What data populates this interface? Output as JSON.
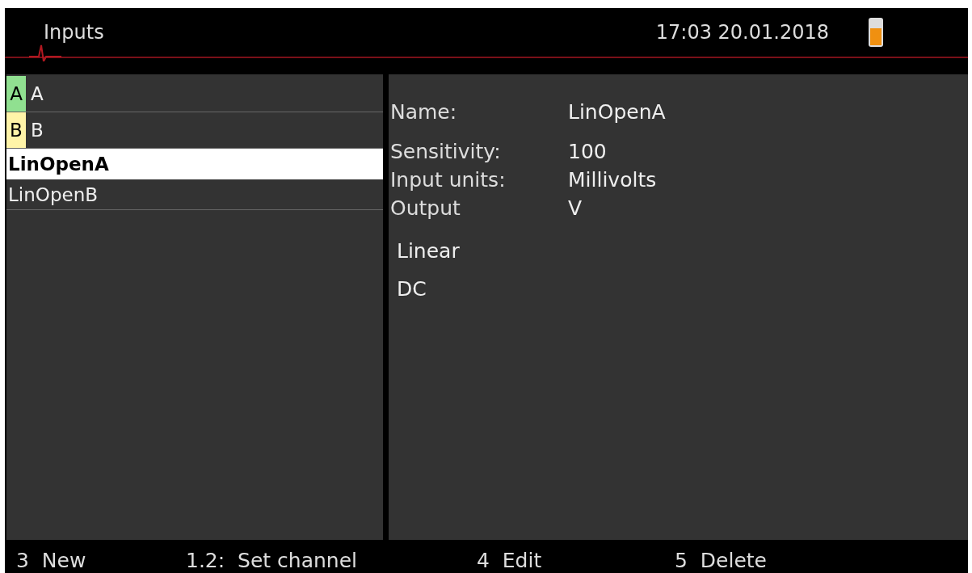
{
  "header": {
    "title": "Inputs",
    "datetime": "17:03 20.01.2018"
  },
  "inputs": [
    {
      "kind": "channel",
      "tag": "A",
      "color": "#90e090",
      "label": "A",
      "selected": false
    },
    {
      "kind": "channel",
      "tag": "B",
      "color": "#fff4a8",
      "label": "B",
      "selected": false
    },
    {
      "kind": "input",
      "label": "LinOpenA",
      "selected": true
    },
    {
      "kind": "input",
      "label": "LinOpenB",
      "selected": false
    }
  ],
  "details": [
    {
      "label": "Name:",
      "value": "LinOpenA"
    },
    {
      "label": "Sensitivity:",
      "value": "100"
    },
    {
      "label": "Input units:",
      "value": "Millivolts"
    },
    {
      "label": "Output",
      "value": "V"
    }
  ],
  "properties": [
    "Linear",
    "DC"
  ],
  "softkeys": [
    {
      "key": "3",
      "label": "New"
    },
    {
      "key": "1.2:",
      "label": "Set channel"
    },
    {
      "key": "4",
      "label": "Edit"
    },
    {
      "key": "5",
      "label": "Delete"
    }
  ]
}
